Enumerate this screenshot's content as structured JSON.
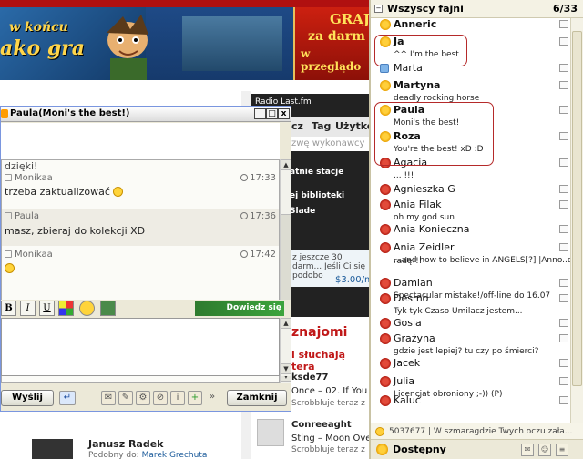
{
  "banner": {
    "left_line1": "w końcu",
    "left_line2": "ako gra",
    "right_line1": "GRAJ",
    "right_line2": "za darm",
    "right_line3": "w przeglądo"
  },
  "radio": {
    "title": "Radio Last.fm",
    "tab_1": "cz",
    "tab_2": "Tag",
    "tab_3": "Użytkow",
    "search_placeholder": "zwę wykonawcy",
    "line_1": "atnie stacje",
    "line_2": "ej biblioteki",
    "line_3": "Slade",
    "promo": "z jeszcze 30 darm... Jeśli Ci się podobo",
    "price": "$3.00/mi"
  },
  "friends": {
    "heading": "znajomi",
    "subheading": "i słuchają tera",
    "items": [
      {
        "name": "ksde77",
        "track": "Once – 02. If You Wa",
        "scrobble": "Scrobbluje teraz z"
      },
      {
        "name": "Conreeaght",
        "track": "Sting – Moon Over B",
        "scrobble": "Scrobbluje teraz z"
      }
    ],
    "janusz_name": "Janusz Radek",
    "janusz_sub_prefix": "Podobny do:",
    "janusz_sub_link": "Marek Grechuta"
  },
  "chat": {
    "title": "Paula(Moni's the best!)",
    "win_min": "_",
    "win_max": "□",
    "win_close": "x",
    "partial_line": "dzięki!",
    "messages": [
      {
        "sender": "Monikaa",
        "time": "17:33",
        "text": "trzeba zaktualizować"
      },
      {
        "sender": "Paula",
        "time": "17:36",
        "text": "masz, zbieraj do kolekcji XD"
      },
      {
        "sender": "Monikaa",
        "time": "17:42",
        "text": ""
      }
    ],
    "fmt_bold": "B",
    "fmt_italic": "I",
    "fmt_underline": "U",
    "ad_text": "Dowiedz się więcej",
    "send_label": "Wyślij",
    "close_label": "Zamknij"
  },
  "contacts": {
    "group_name": "Wszyscy fajni",
    "group_count": "6/33",
    "items": [
      {
        "name": "Anneric",
        "status": "sun",
        "bold": true,
        "desc": ""
      },
      {
        "name": "Ja",
        "status": "sun",
        "bold": true,
        "desc": "^^ I'm the best"
      },
      {
        "name": "Marta",
        "status": "box",
        "bold": false,
        "desc": ""
      },
      {
        "name": "Martyna",
        "status": "sun",
        "bold": true,
        "desc": "deadly rocking horse"
      },
      {
        "name": "Paula",
        "status": "sun",
        "bold": true,
        "desc": "Moni's the best!"
      },
      {
        "name": "Roza",
        "status": "sun",
        "bold": true,
        "desc": "You're the best! xD :D"
      },
      {
        "name": "Agacia",
        "status": "off",
        "bold": false,
        "desc": "... !!!"
      },
      {
        "name": "Agnieszka G",
        "status": "off",
        "bold": false,
        "desc": ""
      },
      {
        "name": "Ania Filak",
        "status": "off",
        "bold": false,
        "desc": "oh my god sun"
      },
      {
        "name": "Ania Konieczna",
        "status": "off",
        "bold": false,
        "desc": ""
      },
      {
        "name": "Ania Zeidler",
        "status": "off",
        "bold": false,
        "desc": "...and how to believe in ANGELS[?] |Anno..dany"
      },
      {
        "name": "",
        "status": "",
        "bold": false,
        "desc": "radę!!!"
      },
      {
        "name": "Damian",
        "status": "off",
        "bold": false,
        "desc": "Spectacular mistake!/off-line do 16.07"
      },
      {
        "name": "Desmo",
        "status": "off",
        "bold": false,
        "desc": "Tyk tyk Czaso Umilacz jestem..."
      },
      {
        "name": "Gosia",
        "status": "off",
        "bold": false,
        "desc": ""
      },
      {
        "name": "Grażyna",
        "status": "off",
        "bold": false,
        "desc": "gdzie jest lepiej? tu czy po śmierci?"
      },
      {
        "name": "Jacek",
        "status": "off",
        "bold": false,
        "desc": ""
      },
      {
        "name": "Julia",
        "status": "off",
        "bold": false,
        "desc": "Licencjat obroniony ;-)) (P)"
      },
      {
        "name": "Kaluć",
        "status": "off",
        "bold": false,
        "desc": ""
      }
    ],
    "status_line": "5037677 | W szmaragdzie Twych oczu zała...",
    "footer_status": "Dostępny"
  }
}
